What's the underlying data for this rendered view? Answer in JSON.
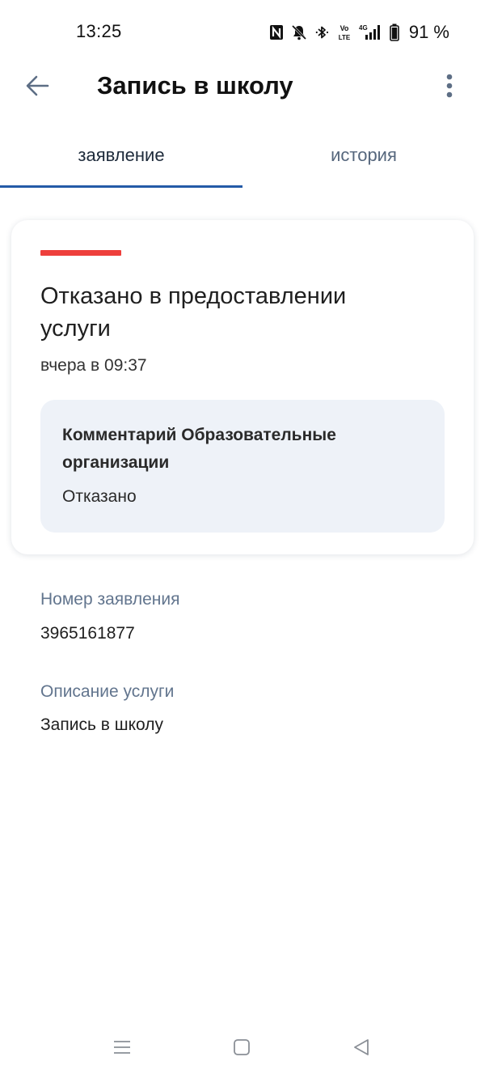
{
  "status_bar": {
    "time": "13:25",
    "battery_percent": "91 %",
    "icons": [
      "nfc-icon",
      "bell-muted-icon",
      "bluetooth-icon",
      "volte-icon",
      "signal-4g-icon",
      "battery-icon"
    ],
    "volte_top": "Vo",
    "volte_bottom": "LTE",
    "network_type": "4G"
  },
  "app_bar": {
    "title": "Запись в школу",
    "back_icon": "arrow-left-icon",
    "more_icon": "more-vertical-icon"
  },
  "tabs": [
    {
      "label": "заявление",
      "active": true
    },
    {
      "label": "история",
      "active": false
    }
  ],
  "status_card": {
    "accent_color": "#ee3f3c",
    "title": "Отказано в предоставлении услуги",
    "time": "вчера в 09:37",
    "comment": {
      "title": "Комментарий Образовательные организации",
      "text": "Отказано"
    }
  },
  "fields": [
    {
      "label": "Номер заявления",
      "value": "3965161877"
    },
    {
      "label": "Описание услуги",
      "value": "Запись в школу"
    }
  ],
  "colors": {
    "accent_blue": "#245ba7",
    "status_red": "#ee3f3c",
    "label_gray": "#62758e"
  },
  "nav_bar": {
    "buttons": [
      "menu-icon",
      "home-square-icon",
      "back-triangle-icon"
    ]
  }
}
